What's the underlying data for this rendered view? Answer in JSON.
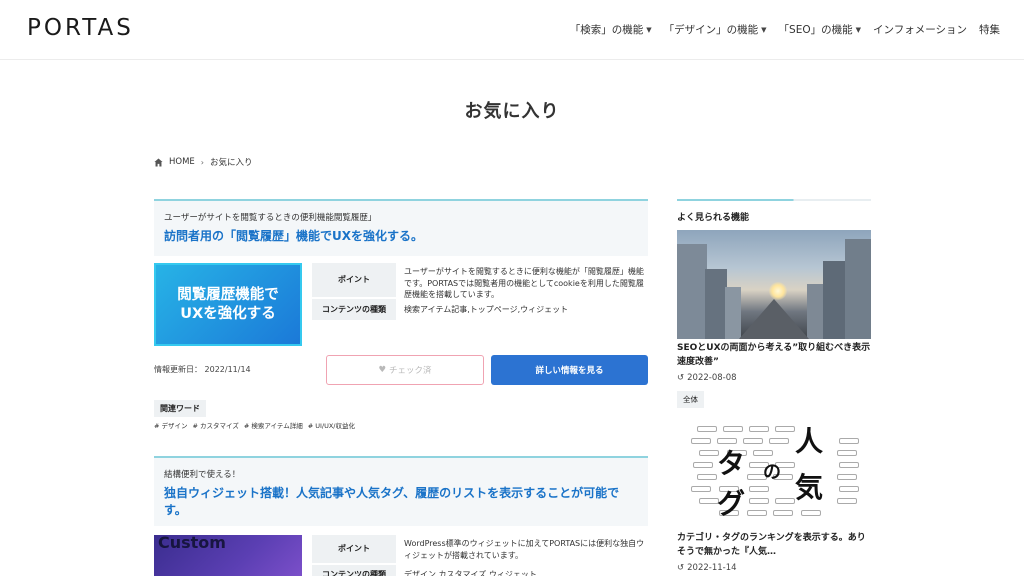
{
  "header": {
    "logo": "PORTAS",
    "nav": [
      {
        "label": "「検索」の機能",
        "dropdown": true
      },
      {
        "label": "「デザイン」の機能",
        "dropdown": true
      },
      {
        "label": "「SEO」の機能",
        "dropdown": true
      },
      {
        "label": "インフォメーション",
        "dropdown": false
      },
      {
        "label": "特集",
        "dropdown": false
      }
    ]
  },
  "page": {
    "title": "お気に入り"
  },
  "breadcrumb": {
    "home": "HOME",
    "current": "お気に入り"
  },
  "articles": [
    {
      "subtitle": "ユーザーがサイトを閲覧するときの便利機能閲覧履歴」",
      "title": "訪問者用の「閲覧履歴」機能でUXを強化する。",
      "thumb_text_1": "閲覧履歴機能で",
      "thumb_text_2": "UXを強化する",
      "point_label": "ポイント",
      "point_text": "ユーザーがサイトを閲覧するときに便利な機能が「閲覧履歴」機能です。PORTASでは閲覧者用の機能としてcookieを利用した閲覧履歴機能を搭載しています。",
      "contents_label": "コンテンツの種類",
      "contents_text": "検索アイテム記事,トップページ,ウィジェット",
      "updated": "情報更新日： 2022/11/14",
      "check_button": "チェック済",
      "detail_button": "詳しい情報を見る",
      "related_label": "関連ワード",
      "tags": [
        "# デザイン",
        "# カスタマイズ",
        "# 検索アイテム詳細",
        "# UI/UX/収益化"
      ]
    },
    {
      "subtitle": "結構便利で使える！",
      "title": "独自ウィジェット搭載！人気記事や人気タグ、履歴のリストを表示することが可能です。",
      "thumb_text": "Custom",
      "point_label": "ポイント",
      "point_text": "WordPress標準のウィジェットに加えてPORTASには便利な独自ウィジェットが搭載されています。",
      "contents_label": "コンテンツの種類",
      "contents_text": "デザイン,カスタマイズ,ウィジェット"
    }
  ],
  "sidebar": {
    "title": "よく見られる機能",
    "items": [
      {
        "title": "SEOとUXの両面から考える”取り組むべき表示速度改善”",
        "date": "2022-08-08",
        "chip": "全体"
      },
      {
        "title": "カテゴリ・タグのランキングを表示する。ありそうで無かった『人気…",
        "date": "2022-11-14",
        "image_chars": [
          "人",
          "気",
          "の",
          "タ",
          "グ"
        ]
      }
    ]
  },
  "colors": {
    "accent_blue": "#2c73d2",
    "title_blue": "#1a73c8",
    "teal_line": "#8fd3df",
    "check_border": "#f0a3b2"
  }
}
